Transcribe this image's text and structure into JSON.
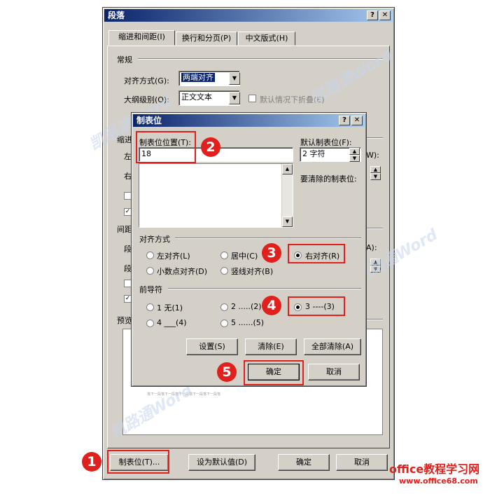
{
  "outer": {
    "title": "段落",
    "help_btn": "?",
    "close_btn": "✕",
    "tabs": [
      "缩进和间距(I)",
      "换行和分页(P)",
      "中文版式(H)"
    ],
    "section_general": "常规",
    "align_label": "对齐方式(G):",
    "align_value": "两端对齐",
    "outline_label": "大纲级别(O):",
    "outline_value": "正文文本",
    "collapse_label": "默认情况下折叠(E)",
    "section_indent_partial": "缩进",
    "left_partial": "左",
    "right_partial": "右",
    "section_spacing_partial": "间距",
    "before_partial": "段",
    "after_partial": "段",
    "preview_partial": "预览",
    "w_label_partial": "W):",
    "a_label_partial": "A):",
    "preview_text_line": "落下一段落下一段落下一段落下一段落下一段落",
    "btn_tabs": "制表位(T)...",
    "btn_default": "设为默认值(D)",
    "btn_ok": "确定",
    "btn_cancel": "取消"
  },
  "tabs_dialog": {
    "title": "制表位",
    "help_btn": "?",
    "close_btn": "✕",
    "position_label": "制表位位置(T):",
    "position_value": "18",
    "default_label": "默认制表位(F):",
    "default_value": "2 字符",
    "clear_label": "要清除的制表位:",
    "align_group": "对齐方式",
    "align_options": [
      "左对齐(L)",
      "居中(C)",
      "右对齐(R)",
      "小数点对齐(D)",
      "竖线对齐(B)"
    ],
    "leader_group": "前导符",
    "leader_options": [
      "1 无(1)",
      "2 .....(2)",
      "3 ----(3)",
      "4 ___(4)",
      "5 ......(5)"
    ],
    "btn_set": "设置(S)",
    "btn_clear": "清除(E)",
    "btn_clear_all": "全部清除(A)",
    "btn_ok": "确定",
    "btn_cancel": "取消"
  },
  "badges": [
    "1",
    "2",
    "3",
    "4",
    "5"
  ],
  "watermark": {
    "brand": "凯路通Word",
    "site_cn": "office教程学习网",
    "site_url": "www.office68.com"
  },
  "colors": {
    "accent_red": "#e0201c",
    "title_blue": "#0a246a",
    "dialog_bg": "#d4d0c8"
  }
}
